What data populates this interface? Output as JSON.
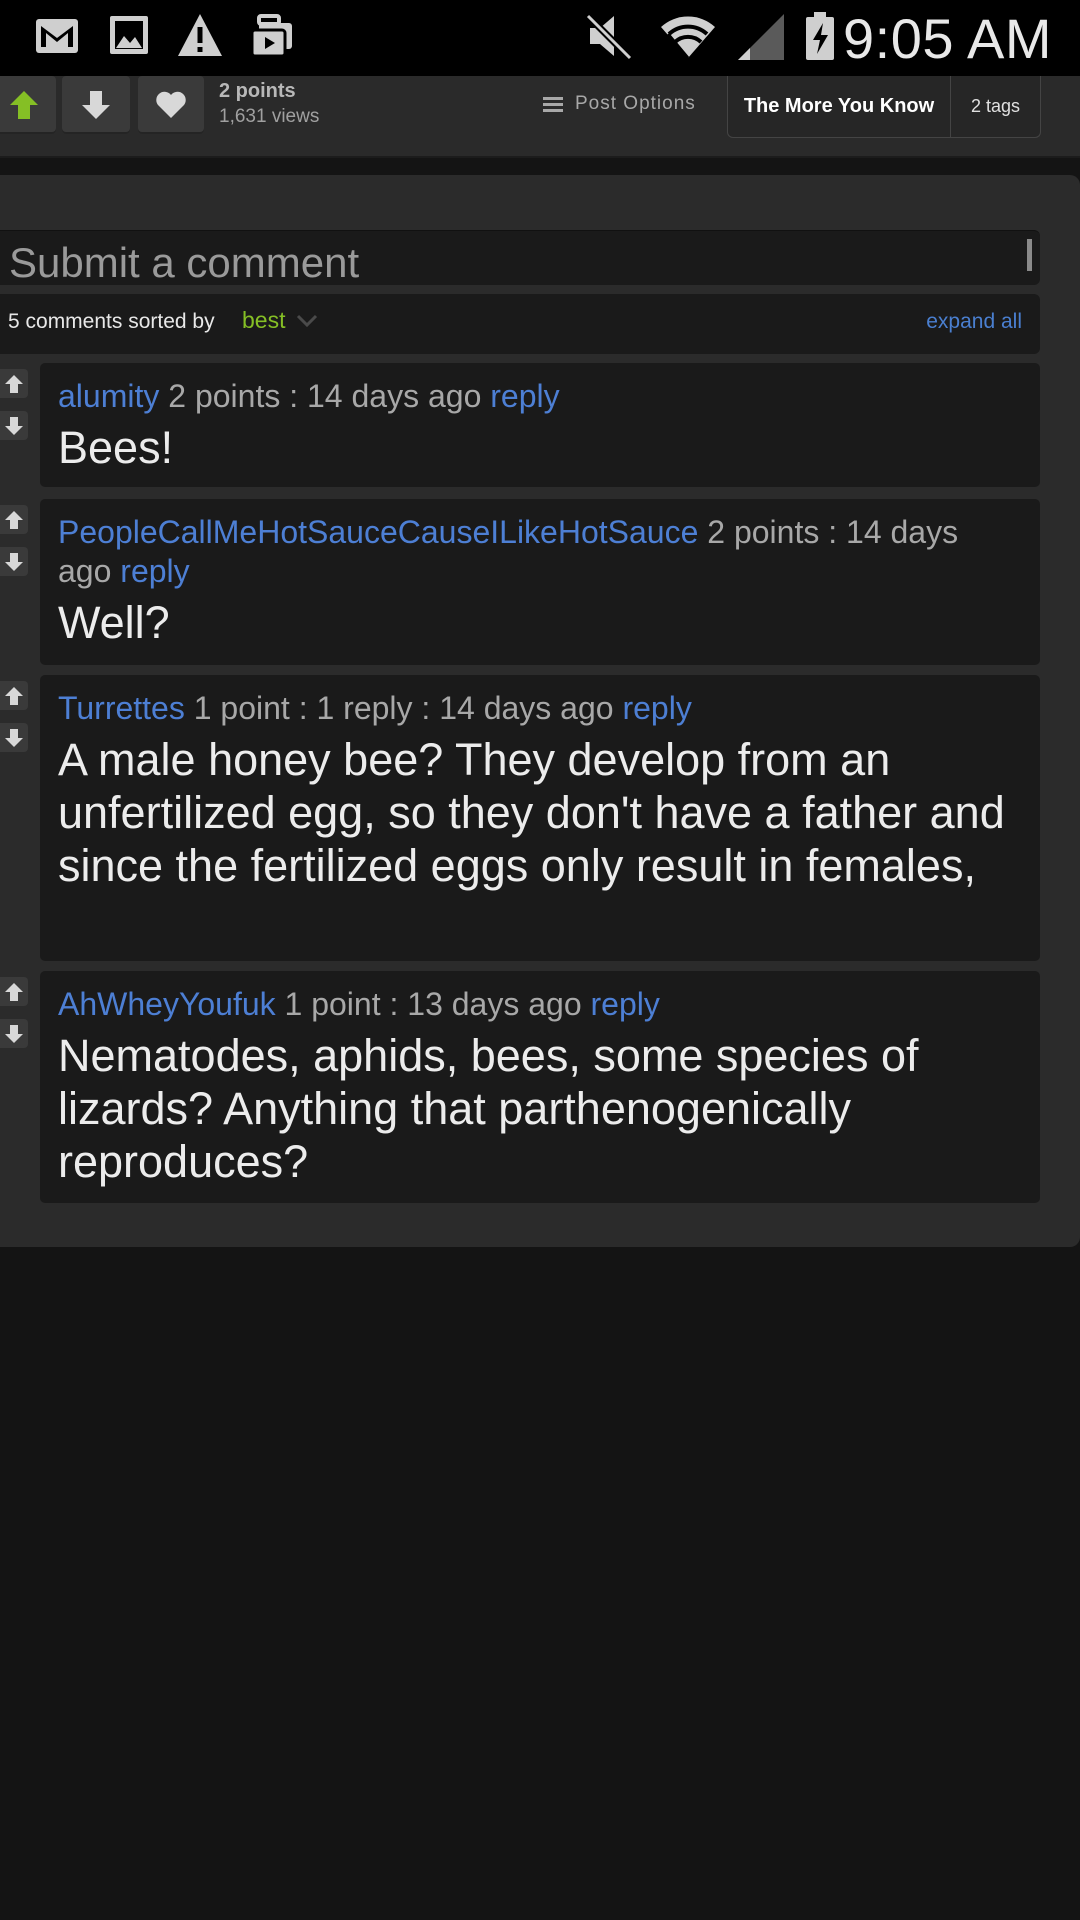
{
  "status_bar": {
    "time": "9:05 AM",
    "left_icons": [
      "gmail-icon",
      "gallery-icon",
      "warning-icon",
      "briefcase-icon"
    ],
    "right_icons": [
      "mute-icon",
      "wifi-icon",
      "signal-icon",
      "battery-charging-icon"
    ]
  },
  "post": {
    "points": "2 points",
    "views": "1,631 views",
    "options_label": "Post Options",
    "tag_main": "The More You Know",
    "tag_count": "2 tags"
  },
  "comments_section": {
    "submit_placeholder": "Submit a comment",
    "sort_prefix": "5 comments sorted by",
    "sort_value": "best",
    "expand_label": "expand all",
    "comments": [
      {
        "user": "alumity",
        "info": " 2 points : 14 days ago ",
        "reply": "reply",
        "text": "Bees!"
      },
      {
        "user": "PeopleCallMeHotSauceCauseILikeHotSauce",
        "info": " 2 points : 14 days ago ",
        "reply": "reply",
        "text": "Well?"
      },
      {
        "user": "Turrettes",
        "info": " 1 point : 1 reply : 14 days ago ",
        "reply": "reply",
        "text": "A male honey bee? They develop from an unfertilized egg, so they don't have a father and since the fertilized eggs only result in females,"
      },
      {
        "user": "AhWheyYoufuk",
        "info": " 1 point : 13 days ago ",
        "reply": "reply",
        "text": "Nematodes, aphids, bees, some species of lizards? Anything that parthenogenically reproduces?"
      }
    ]
  },
  "colors": {
    "accent_green": "#85bf25",
    "link_blue": "#4d7fd4",
    "background": "#141414",
    "panel": "#2b2b2b"
  }
}
